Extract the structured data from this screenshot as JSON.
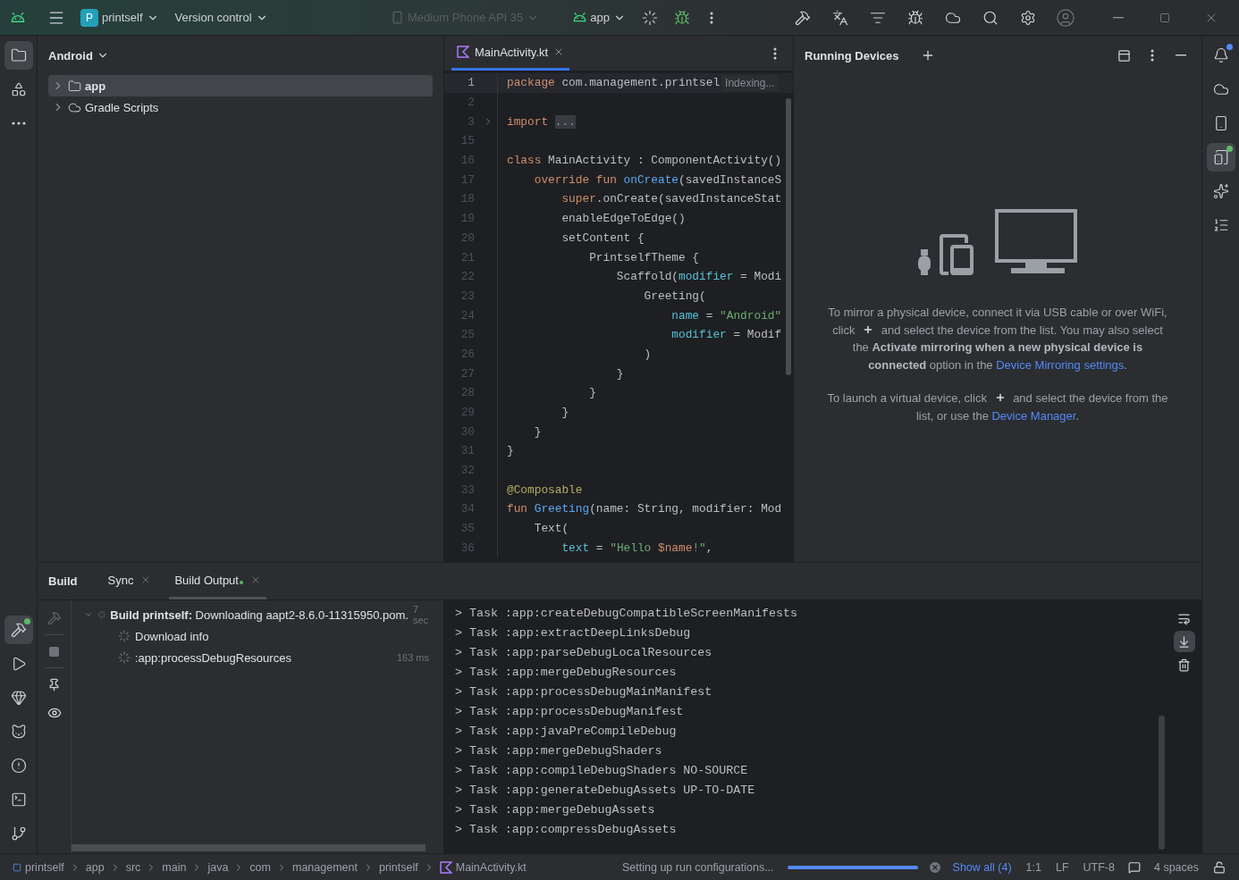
{
  "title_bar": {
    "project_badge": "P",
    "project": "printself",
    "vcs": "Version control",
    "device": {
      "label": "Medium Phone API 35",
      "disabled": true
    },
    "run_config": "app"
  },
  "left_strip": {
    "top": [
      {
        "selected": true
      },
      {
        "selected": false
      },
      {
        "selected": false
      }
    ],
    "bottom": [
      {
        "selected": true,
        "dot": true
      },
      {
        "selected": false,
        "dot": false
      },
      {
        "selected": false,
        "dot": false
      },
      {
        "selected": false,
        "dot": false
      },
      {
        "selected": false,
        "dot": false
      },
      {
        "selected": false,
        "dot": false
      },
      {
        "selected": false,
        "dot": false
      }
    ]
  },
  "project": {
    "view": "Android",
    "items": [
      {
        "label": "app",
        "selected": true,
        "expanded": false
      },
      {
        "label": "Gradle Scripts",
        "selected": false,
        "expanded": false
      }
    ]
  },
  "editor": {
    "tabs": [
      {
        "label": "MainActivity.kt",
        "selected": true
      }
    ],
    "indexing": "Indexing...",
    "lines": [
      {
        "number": "1",
        "current": true,
        "collapsed": false,
        "tokens": [
          {
            "kind": "kw",
            "text": "package"
          },
          {
            "kind": "plain",
            "text": " com.management.printsel"
          }
        ]
      },
      {
        "number": "2",
        "current": false,
        "collapsed": false
      },
      {
        "number": "3",
        "current": false,
        "collapsed": true,
        "tokens": [
          {
            "kind": "kw",
            "text": "import "
          },
          {
            "kind": "folded",
            "text": "..."
          }
        ]
      },
      {
        "number": "15",
        "current": false,
        "collapsed": false
      },
      {
        "number": "16",
        "current": false,
        "collapsed": false,
        "tokens": [
          {
            "kind": "kw",
            "text": "class"
          },
          {
            "kind": "plain",
            "text": " MainActivity : ComponentActivity()"
          }
        ]
      },
      {
        "number": "17",
        "current": false,
        "collapsed": false,
        "tokens": [
          {
            "kind": "kw",
            "text": "    override fun "
          },
          {
            "kind": "fn",
            "text": "onCreate"
          },
          {
            "kind": "plain",
            "text": "(savedInstanceS"
          }
        ]
      },
      {
        "number": "18",
        "current": false,
        "collapsed": false,
        "tokens": [
          {
            "kind": "kw",
            "text": "        super"
          },
          {
            "kind": "plain",
            "text": ".onCreate(savedInstanceStat"
          }
        ]
      },
      {
        "number": "19",
        "current": false,
        "collapsed": false,
        "tokens": [
          {
            "kind": "plain",
            "text": "        enableEdgeToEdge()"
          }
        ]
      },
      {
        "number": "20",
        "current": false,
        "collapsed": false,
        "tokens": [
          {
            "kind": "plain",
            "text": "        setContent {"
          }
        ]
      },
      {
        "number": "21",
        "current": false,
        "collapsed": false,
        "tokens": [
          {
            "kind": "plain",
            "text": "            PrintselfTheme {"
          }
        ]
      },
      {
        "number": "22",
        "current": false,
        "collapsed": false,
        "tokens": [
          {
            "kind": "plain",
            "text": "                Scaffold("
          },
          {
            "kind": "param",
            "text": "modifier"
          },
          {
            "kind": "plain",
            "text": " = Modi"
          }
        ]
      },
      {
        "number": "23",
        "current": false,
        "collapsed": false,
        "tokens": [
          {
            "kind": "plain",
            "text": "                    Greeting("
          }
        ]
      },
      {
        "number": "24",
        "current": false,
        "collapsed": false,
        "tokens": [
          {
            "kind": "param",
            "text": "                        name"
          },
          {
            "kind": "plain",
            "text": " = "
          },
          {
            "kind": "string",
            "text": "\"Android\""
          }
        ]
      },
      {
        "number": "25",
        "current": false,
        "collapsed": false,
        "tokens": [
          {
            "kind": "param",
            "text": "                        modifier"
          },
          {
            "kind": "plain",
            "text": " = Modif"
          }
        ]
      },
      {
        "number": "26",
        "current": false,
        "collapsed": false,
        "tokens": [
          {
            "kind": "plain",
            "text": "                    )"
          }
        ]
      },
      {
        "number": "27",
        "current": false,
        "collapsed": false,
        "tokens": [
          {
            "kind": "plain",
            "text": "                }"
          }
        ]
      },
      {
        "number": "28",
        "current": false,
        "collapsed": false,
        "tokens": [
          {
            "kind": "plain",
            "text": "            }"
          }
        ]
      },
      {
        "number": "29",
        "current": false,
        "collapsed": false,
        "tokens": [
          {
            "kind": "plain",
            "text": "        }"
          }
        ]
      },
      {
        "number": "30",
        "current": false,
        "collapsed": false,
        "tokens": [
          {
            "kind": "plain",
            "text": "    }"
          }
        ]
      },
      {
        "number": "31",
        "current": false,
        "collapsed": false,
        "tokens": [
          {
            "kind": "plain",
            "text": "}"
          }
        ]
      },
      {
        "number": "32",
        "current": false,
        "collapsed": false
      },
      {
        "number": "33",
        "current": false,
        "collapsed": false,
        "tokens": [
          {
            "kind": "annotation",
            "text": "@Composable"
          }
        ]
      },
      {
        "number": "34",
        "current": false,
        "collapsed": false,
        "tokens": [
          {
            "kind": "kw",
            "text": "fun "
          },
          {
            "kind": "fn",
            "text": "Greeting"
          },
          {
            "kind": "plain",
            "text": "(name: String, modifier: Mod"
          }
        ]
      },
      {
        "number": "35",
        "current": false,
        "collapsed": false,
        "tokens": [
          {
            "kind": "plain",
            "text": "    Text("
          }
        ]
      },
      {
        "number": "36",
        "current": false,
        "collapsed": false,
        "tokens": [
          {
            "kind": "param",
            "text": "        text"
          },
          {
            "kind": "plain",
            "text": " = "
          },
          {
            "kind": "string",
            "text": "\"Hello "
          },
          {
            "kind": "kw",
            "text": "$name"
          },
          {
            "kind": "string",
            "text": "!\""
          },
          {
            "kind": "plain",
            "text": ","
          }
        ]
      }
    ]
  },
  "running_devices": {
    "title": "Running Devices",
    "paragraphs": [
      [
        {
          "kind": "text",
          "text": "To mirror a physical device, connect it via USB cable or over WiFi, click "
        },
        {
          "kind": "plus"
        },
        {
          "kind": "text",
          "text": " and select the device from the list. You may also select the "
        },
        {
          "kind": "bold",
          "text": "Activate mirroring when a new physical device is connected"
        },
        {
          "kind": "text",
          "text": " option in the "
        },
        {
          "kind": "link",
          "text": "Device Mirroring settings"
        },
        {
          "kind": "text",
          "text": "."
        }
      ],
      [
        {
          "kind": "text",
          "text": "To launch a virtual device, click "
        },
        {
          "kind": "plus"
        },
        {
          "kind": "text",
          "text": " and select the device from the list, or use the "
        },
        {
          "kind": "link",
          "text": "Device Manager"
        },
        {
          "kind": "text",
          "text": "."
        }
      ]
    ]
  },
  "build": {
    "title": "Build",
    "tabs": [
      {
        "label": "Sync",
        "selected": false,
        "dot": false
      },
      {
        "label": "Build Output",
        "selected": true,
        "dot": true
      }
    ],
    "tree": [
      {
        "label": "**Build printself:** Downloading aapt2-8.6.0-11315950.pom.",
        "time": "7 sec",
        "expanded": true,
        "children": [
          {
            "label": "Download info"
          },
          {
            "label": ":app:processDebugResources",
            "time": "163 ms"
          }
        ]
      }
    ],
    "output": [
      "> Task :app:createDebugCompatibleScreenManifests",
      "> Task :app:extractDeepLinksDebug",
      "> Task :app:parseDebugLocalResources",
      "> Task :app:mergeDebugResources",
      "> Task :app:processDebugMainManifest",
      "> Task :app:processDebugManifest",
      "> Task :app:javaPreCompileDebug",
      "> Task :app:mergeDebugShaders",
      "> Task :app:compileDebugShaders NO-SOURCE",
      "> Task :app:generateDebugAssets UP-TO-DATE",
      "> Task :app:mergeDebugAssets",
      "> Task :app:compressDebugAssets"
    ],
    "tools": [
      {
        "selected": false
      },
      {
        "selected": true
      },
      {
        "selected": false
      }
    ]
  },
  "right_strip": [
    {
      "selected": false,
      "color": "#548af7"
    },
    {
      "selected": false
    },
    {
      "selected": false
    },
    {
      "selected": true,
      "color": "#5fb865"
    },
    {
      "selected": false
    },
    {
      "selected": false
    }
  ],
  "status_bar": {
    "breadcrumb": [
      "printself",
      "app",
      "src",
      "main",
      "java",
      "com",
      "management",
      "printself",
      "MainActivity.kt"
    ],
    "task": "Setting up run configurations...",
    "progress": {
      "level": 1
    },
    "show_all": "Show all (4)",
    "position": "1:1",
    "line_separator": "LF",
    "encoding": "UTF-8",
    "indent": "4 spaces"
  }
}
